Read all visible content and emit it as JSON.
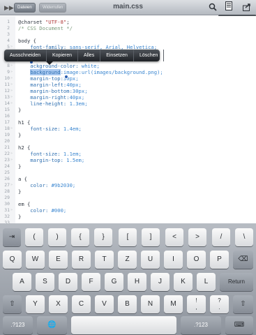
{
  "toolbar": {
    "file_button": "Dateien",
    "undo_button": "Widerrufen",
    "title": "main.css",
    "icons": [
      "expand-icon",
      "search-icon",
      "document-icon",
      "share-icon"
    ]
  },
  "info": {
    "line_label": "Zeile:",
    "line_value": "9",
    "column_label": "Spalte:",
    "column_value": "15"
  },
  "context_menu": {
    "items": [
      "Ausschneiden",
      "Kopieren",
      "Alles",
      "Einsetzen",
      "Löschen"
    ]
  },
  "code": {
    "lines": [
      {
        "n": "1",
        "parts": [
          {
            "t": "@charset ",
            "c": "kw"
          },
          {
            "t": "\"UTF-8\"",
            "c": "str"
          },
          {
            "t": ";",
            "c": "punc"
          }
        ]
      },
      {
        "n": "2",
        "parts": [
          {
            "t": "/* CSS Document */",
            "c": "com"
          }
        ]
      },
      {
        "n": "3",
        "parts": []
      },
      {
        "n": "4",
        "parts": [
          {
            "t": "body {",
            "c": "kw"
          }
        ]
      },
      {
        "n": "5",
        "parts": [
          {
            "t": "    font-family: ",
            "c": "prop"
          },
          {
            "t": "sans-serif, Arial, Helvetica;",
            "c": "val"
          }
        ]
      },
      {
        "n": "6",
        "parts": [
          {
            "t": "    font-size: ",
            "c": "prop"
          },
          {
            "t": "0.8em;",
            "c": "val"
          }
        ]
      },
      {
        "n": "7",
        "parts": [
          {
            "t": "    ",
            "c": "prop"
          }
        ]
      },
      {
        "n": "8",
        "parts": [
          {
            "t": "    ackground-color: ",
            "c": "prop"
          },
          {
            "t": "white;",
            "c": "val"
          }
        ]
      },
      {
        "n": "9",
        "parts": [
          {
            "t": "    ",
            "c": "prop"
          },
          {
            "t": "background",
            "c": "sel"
          },
          {
            "t": ":",
            "c": "prop"
          },
          {
            "t": "image:url(images/background.png);",
            "c": "val"
          }
        ]
      },
      {
        "n": "10",
        "parts": [
          {
            "t": "    margin-top:",
            "c": "prop"
          },
          {
            "t": "30px;",
            "c": "val"
          }
        ]
      },
      {
        "n": "11",
        "parts": [
          {
            "t": "    margin-left:",
            "c": "prop"
          },
          {
            "t": "40px;",
            "c": "val"
          }
        ]
      },
      {
        "n": "12",
        "parts": [
          {
            "t": "    margin-bottom:",
            "c": "prop"
          },
          {
            "t": "30px;",
            "c": "val"
          }
        ]
      },
      {
        "n": "13",
        "parts": [
          {
            "t": "    margin-right:",
            "c": "prop"
          },
          {
            "t": "40px;",
            "c": "val"
          }
        ]
      },
      {
        "n": "14",
        "parts": [
          {
            "t": "    line-height: ",
            "c": "prop"
          },
          {
            "t": "1.3em;",
            "c": "val"
          }
        ]
      },
      {
        "n": "15",
        "parts": [
          {
            "t": "}",
            "c": "kw"
          }
        ]
      },
      {
        "n": "16",
        "parts": []
      },
      {
        "n": "17",
        "parts": [
          {
            "t": "h1 {",
            "c": "kw"
          }
        ]
      },
      {
        "n": "18",
        "parts": [
          {
            "t": "    font-size: ",
            "c": "prop"
          },
          {
            "t": "1.4em;",
            "c": "val"
          }
        ]
      },
      {
        "n": "19",
        "parts": [
          {
            "t": "}",
            "c": "kw"
          }
        ]
      },
      {
        "n": "20",
        "parts": []
      },
      {
        "n": "21",
        "parts": [
          {
            "t": "h2 {",
            "c": "kw"
          }
        ]
      },
      {
        "n": "22",
        "parts": [
          {
            "t": "    font-size: ",
            "c": "prop"
          },
          {
            "t": "1.1em;",
            "c": "val"
          }
        ]
      },
      {
        "n": "23",
        "parts": [
          {
            "t": "    margin-top: ",
            "c": "prop"
          },
          {
            "t": "1.5em;",
            "c": "val"
          }
        ]
      },
      {
        "n": "24",
        "parts": [
          {
            "t": "}",
            "c": "kw"
          }
        ]
      },
      {
        "n": "25",
        "parts": []
      },
      {
        "n": "26",
        "parts": [
          {
            "t": "a {",
            "c": "kw"
          }
        ]
      },
      {
        "n": "27",
        "parts": [
          {
            "t": "    color: ",
            "c": "prop"
          },
          {
            "t": "#9b2030;",
            "c": "val"
          }
        ]
      },
      {
        "n": "28",
        "parts": [
          {
            "t": "}",
            "c": "kw"
          }
        ]
      },
      {
        "n": "29",
        "parts": []
      },
      {
        "n": "30",
        "parts": [
          {
            "t": "em {",
            "c": "kw"
          }
        ]
      },
      {
        "n": "31",
        "parts": [
          {
            "t": "    color: ",
            "c": "prop"
          },
          {
            "t": "#000;",
            "c": "val"
          }
        ]
      },
      {
        "n": "32",
        "parts": [
          {
            "t": "}",
            "c": "kw"
          }
        ]
      },
      {
        "n": "33",
        "parts": []
      },
      {
        "n": "34",
        "parts": [
          {
            "t": "#content {",
            "c": "kw"
          }
        ]
      }
    ]
  },
  "keyboard": {
    "row1": [
      "⇥",
      "(",
      ")",
      "{",
      "}",
      "[",
      "]",
      "<",
      ">",
      "/",
      "\\"
    ],
    "row2": [
      "Q",
      "W",
      "E",
      "R",
      "T",
      "Z",
      "U",
      "I",
      "O",
      "P",
      "⌫"
    ],
    "row3": [
      "A",
      "S",
      "D",
      "F",
      "G",
      "H",
      "J",
      "K",
      "L",
      "Return"
    ],
    "row4": [
      "⇧",
      "Y",
      "X",
      "C",
      "V",
      "B",
      "N",
      "M",
      "!",
      ",",
      "?",
      ".",
      "⇧"
    ],
    "row5": [
      ".?123",
      "🌐",
      ".?123",
      "⌨"
    ]
  },
  "colors": {
    "selection": "#a8c8f0",
    "string": "#b03a3a",
    "value": "#3a86d0",
    "comment": "#7d9c7d"
  }
}
